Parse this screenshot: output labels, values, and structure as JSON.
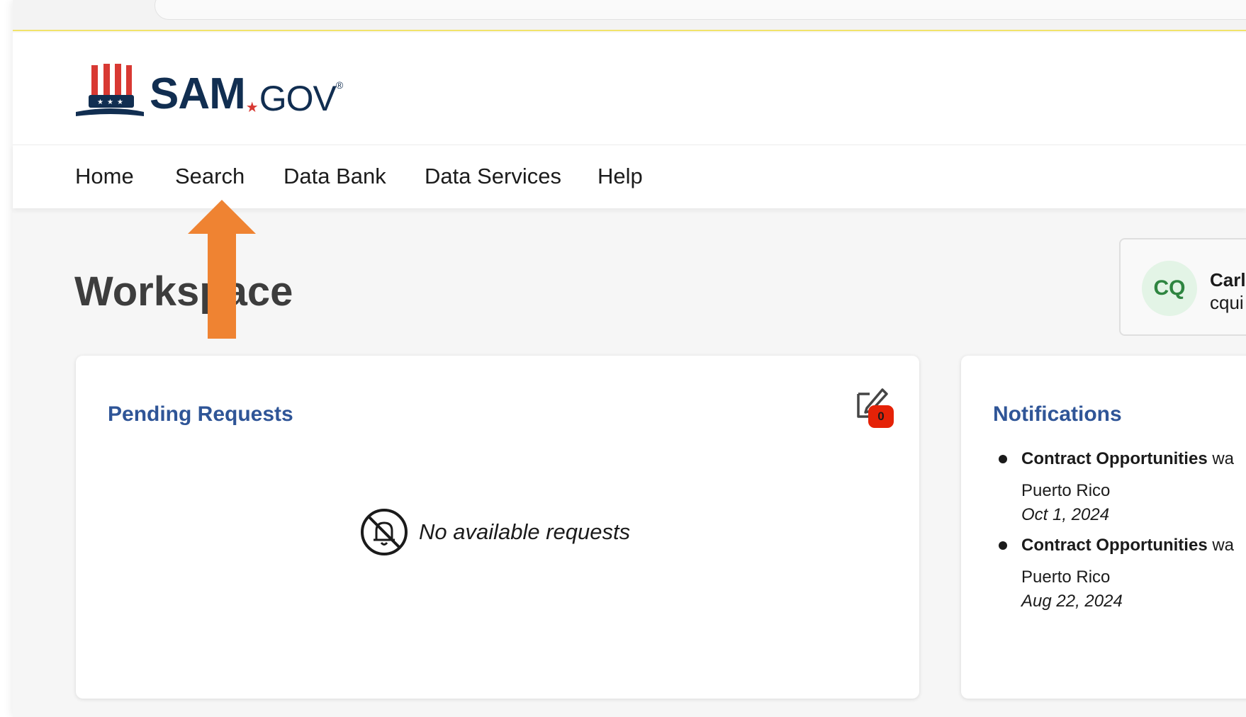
{
  "header": {
    "logo": {
      "sam": "SAM",
      "gov": "GOV",
      "registered": "®"
    }
  },
  "nav": {
    "items": [
      {
        "label": "Home"
      },
      {
        "label": "Search"
      },
      {
        "label": "Data Bank"
      },
      {
        "label": "Data Services"
      },
      {
        "label": "Help"
      }
    ]
  },
  "page": {
    "title": "Workspace"
  },
  "user": {
    "initials": "CQ",
    "name": "Carl",
    "email": "cqui"
  },
  "pending": {
    "title": "Pending Requests",
    "badge_count": "0",
    "empty_message": "No available requests"
  },
  "notifications": {
    "title": "Notifications",
    "items": [
      {
        "source": "Contract Opportunities",
        "verb": "wa",
        "location": "Puerto Rico",
        "date": "Oct 1, 2024"
      },
      {
        "source": "Contract Opportunities",
        "verb": "wa",
        "location": "Puerto Rico",
        "date": "Aug 22, 2024"
      }
    ]
  },
  "colors": {
    "brand_navy": "#112e51",
    "brand_red": "#d83933",
    "link_blue": "#2f5597",
    "annotation_arrow": "#ef8332",
    "badge_red": "#e52207",
    "avatar_green": "#2e8540"
  }
}
